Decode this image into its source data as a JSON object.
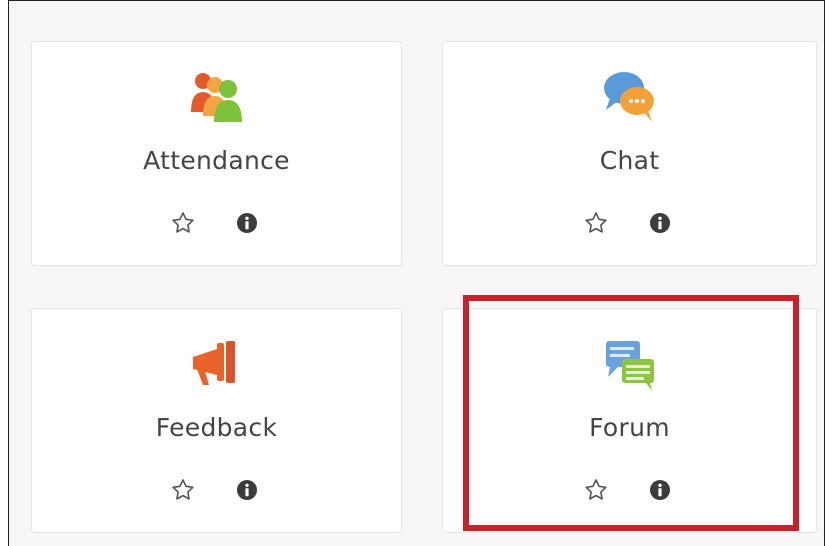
{
  "modules": [
    {
      "label": "Attendance",
      "icon": "attendance-people-icon",
      "favorite_icon": "star-outline-icon",
      "info_icon": "info-circle-icon"
    },
    {
      "label": "Chat",
      "icon": "chat-bubbles-icon",
      "favorite_icon": "star-outline-icon",
      "info_icon": "info-circle-icon"
    },
    {
      "label": "Feedback",
      "icon": "megaphone-icon",
      "favorite_icon": "star-outline-icon",
      "info_icon": "info-circle-icon"
    },
    {
      "label": "Forum",
      "icon": "forum-discussion-icon",
      "favorite_icon": "star-outline-icon",
      "info_icon": "info-circle-icon"
    }
  ],
  "highlighted_module": "Forum",
  "colors": {
    "highlight_border": "#c8212b",
    "label_text": "#444444",
    "card_border": "#e4e4e7"
  }
}
